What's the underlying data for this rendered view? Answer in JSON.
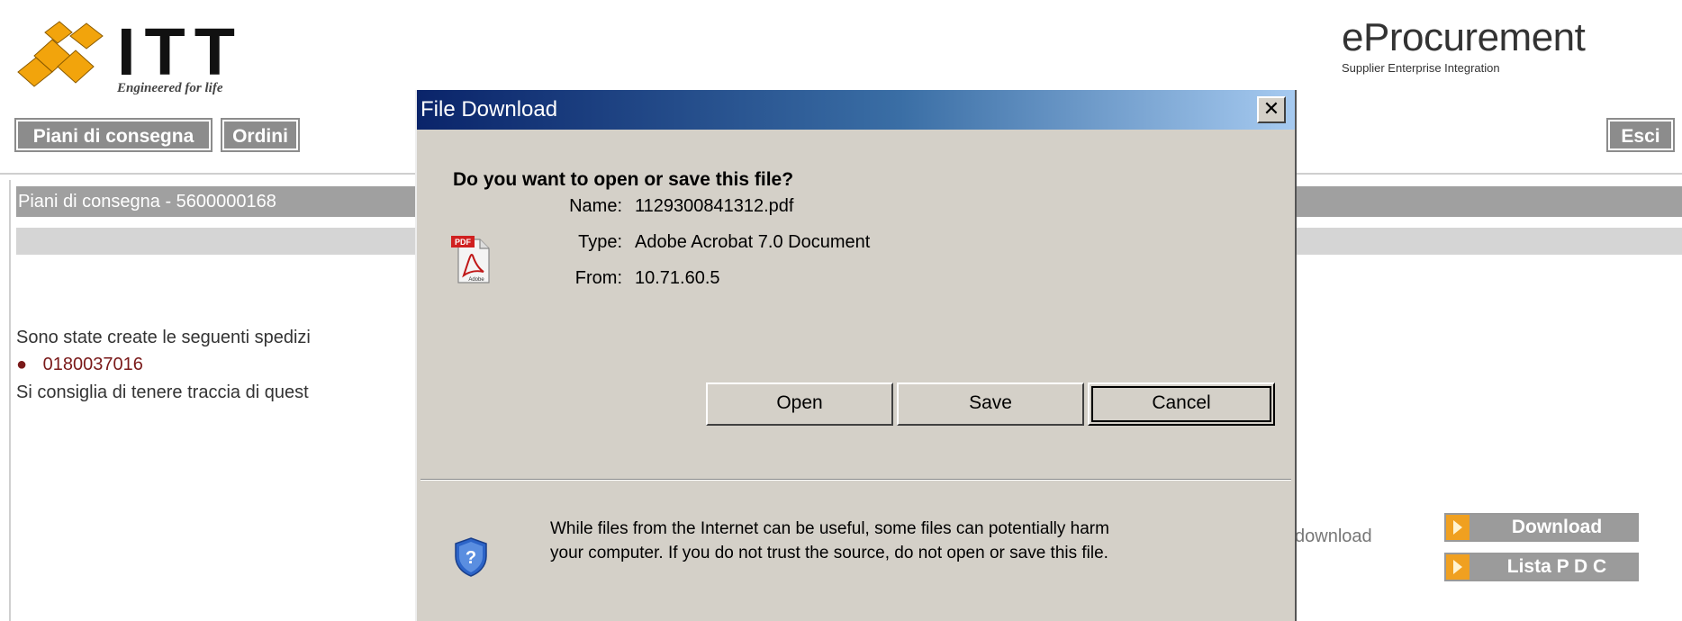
{
  "header": {
    "logo_text": "ITT",
    "logo_tagline": "Engineered for life",
    "brand_title": "eProcurement",
    "brand_subtitle": "Supplier Enterprise Integration"
  },
  "nav": {
    "piani": "Piani di consegna",
    "ordini": "Ordini",
    "esci": "Esci"
  },
  "content": {
    "section_title": "Piani di consegna - 5600000168",
    "line1": "Sono state create le seguenti spedizi",
    "bullet": "●",
    "shipment_number": "0180037016",
    "line2": "Si consiglia di tenere traccia di quest",
    "download_label": "i download",
    "download_button": "Download",
    "lista_button": "Lista P D C"
  },
  "dialog": {
    "title": "File Download",
    "close": "✕",
    "question": "Do you want to open or save this file?",
    "name_label": "Name:",
    "name_value": "1129300841312.pdf",
    "type_label": "Type:",
    "type_value": "Adobe Acrobat 7.0 Document",
    "from_label": "From:",
    "from_value": "10.71.60.5",
    "open": "Open",
    "save": "Save",
    "cancel": "Cancel",
    "warning_line1": "While files from the Internet can be useful, some files can potentially harm",
    "warning_line2": "your computer. If you do not trust the source, do not open or save this file.",
    "pdf_icon_text": "PDF",
    "adobe_text": "Adobe",
    "shield_symbol": "?"
  },
  "icons": {
    "logo": "itt-diamond-logo",
    "pdf": "pdf-file-icon",
    "shield": "security-shield-icon",
    "arrow": "orange-arrow-icon"
  },
  "colors": {
    "nav_bg": "#8c8c8c",
    "section_bg": "#a0a0a0",
    "accent_orange": "#f0a020",
    "link_red": "#7a1a1a",
    "dialog_bg": "#d4d0c8"
  }
}
